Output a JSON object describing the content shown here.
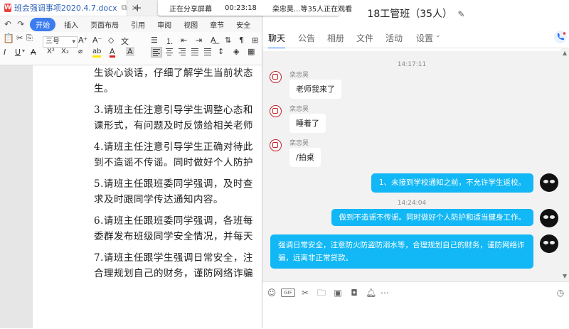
{
  "wps": {
    "doc_tab_title": "班会强调事项2020.4.7.docx",
    "new_tab": "+",
    "menu": {
      "start_label": "开始",
      "items": [
        "插入",
        "页面布局",
        "引用",
        "审阅",
        "视图",
        "章节",
        "安全"
      ]
    },
    "toolbar": {
      "font_name": "",
      "font_size": "三号",
      "font_grow": "A⁺",
      "font_shrink": "A⁻",
      "format_text": "文",
      "italic": "I",
      "underline": "U",
      "strike": "A",
      "superscript": "X²",
      "subscript": "X₂",
      "highlight": "ab",
      "font_color": "A",
      "char_shading": "A",
      "accent_color": "#3b7cf0"
    },
    "doc": {
      "paragraphs": [
        "生谈心谈话，仔细了解学生当前状态",
        "生。",
        "3.请班主任注意引导学生调整心态和",
        "课形式，有问题及时反馈给相关老师",
        "4.请班主任注意引导学生正确对待此",
        "到不造谣不传谣。同时做好个人防护",
        "5.请班主任跟班委同学强调，及时查",
        "求及时跟同学传达通知内容。",
        "6.请班主任跟班委同学强调，各班每",
        "委群发布班级同学安全情况，并每天",
        "7.请班主任跟学生强调日常安全，注",
        "合理规划自己的财务，谨防网络诈骗"
      ]
    }
  },
  "share": {
    "status": "正在分享屏幕",
    "timer": "00:23:18",
    "viewers": "栾忠昊...等35人正在观看"
  },
  "qq": {
    "group_title": "18工管班（35人）",
    "edit_icon": "✎",
    "tabs": [
      "聊天",
      "公告",
      "相册",
      "文件",
      "活动",
      "设置"
    ],
    "timestamps": [
      "14:17:11",
      "14:24:04"
    ],
    "messages_left": [
      {
        "sender": "栾忠昊",
        "text": "老师我来了"
      },
      {
        "sender": "栾忠昊",
        "text": "睡着了"
      },
      {
        "sender": "栾忠昊",
        "text": "/拍桌"
      }
    ],
    "messages_right": [
      {
        "text": "1、未接到学校通知之前，不允许学生返校。"
      },
      {
        "text": "做到不造谣不传谣。同时做好个人防护和适当健身工作。"
      },
      {
        "text_line1": "强调日常安全，注意防火防盗防溺水等，合理规划自己的财务，谨防网络诈",
        "text_line2": "骗，远离非正常贷款。"
      }
    ],
    "input_toolbar": {
      "gif_label": "GIF",
      "icons": [
        "emoji-icon",
        "gif-icon",
        "scissors-icon",
        "folder-icon",
        "image-icon",
        "shake-icon",
        "bell-icon",
        "more-icon",
        "history-icon"
      ]
    },
    "accent_color": "#12b7f5",
    "tab_underline_color": "#1e6fff"
  }
}
